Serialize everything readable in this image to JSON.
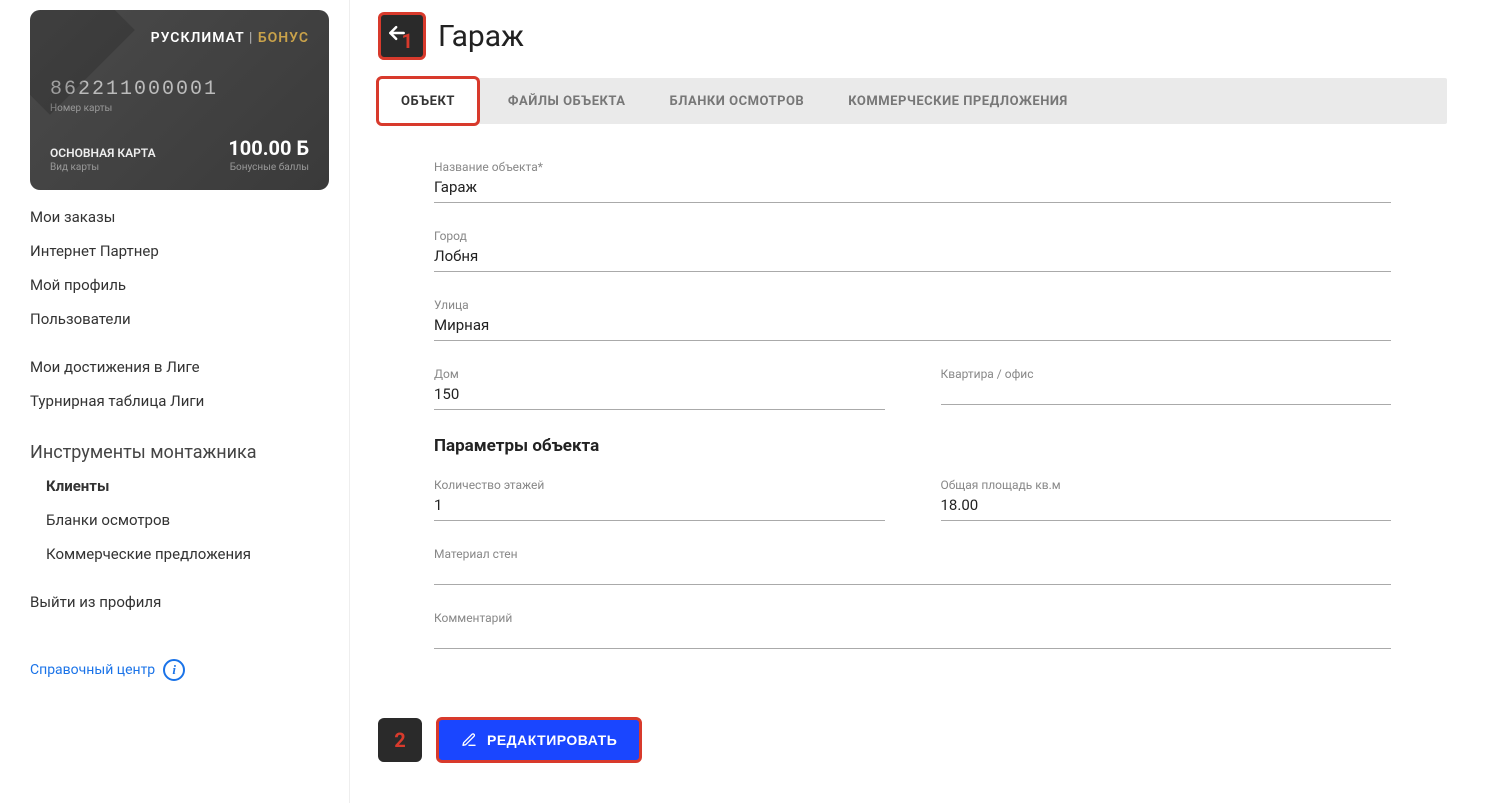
{
  "card": {
    "brand_main": "РУСКЛИМАТ",
    "brand_sep": " | ",
    "brand_bonus": "БОНУС",
    "number": "862211000001",
    "number_label": "Номер карты",
    "type": "ОСНОВНАЯ КАРТА",
    "type_label": "Вид карты",
    "balance": "100.00 Б",
    "balance_label": "Бонусные баллы"
  },
  "nav": {
    "orders": "Мои заказы",
    "partner": "Интернет Партнер",
    "profile": "Мой профиль",
    "users": "Пользователи",
    "achievements": "Мои достижения в Лиге",
    "league_table": "Турнирная таблица Лиги",
    "tools_header": "Инструменты монтажника",
    "clients": "Клиенты",
    "inspection_forms": "Бланки осмотров",
    "offers": "Коммерческие предложения",
    "logout": "Выйти из профиля",
    "help": "Справочный центр"
  },
  "page": {
    "title": "Гараж",
    "callout1": "1",
    "callout2": "2"
  },
  "tabs": {
    "object": "ОБЪЕКТ",
    "files": "ФАЙЛЫ ОБЪЕКТА",
    "inspections": "БЛАНКИ ОСМОТРОВ",
    "offers": "КОММЕРЧЕСКИЕ ПРЕДЛОЖЕНИЯ"
  },
  "form": {
    "name_label": "Название объекта*",
    "name_value": "Гараж",
    "city_label": "Город",
    "city_value": "Лобня",
    "street_label": "Улица",
    "street_value": "Мирная",
    "house_label": "Дом",
    "house_value": "150",
    "apt_label": "Квартира / офис",
    "apt_value": "",
    "params_header": "Параметры объекта",
    "floors_label": "Количество этажей",
    "floors_value": "1",
    "area_label": "Общая площадь кв.м",
    "area_value": "18.00",
    "wall_label": "Материал стен",
    "wall_value": "",
    "comment_label": "Комментарий",
    "comment_value": ""
  },
  "buttons": {
    "edit": "РЕДАКТИРОВАТЬ"
  }
}
